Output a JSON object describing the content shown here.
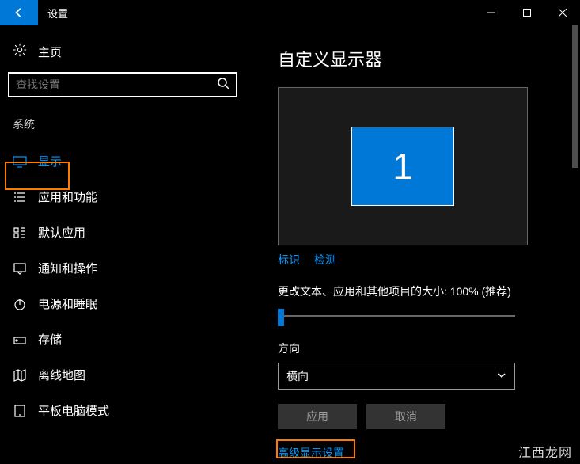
{
  "window": {
    "title": "设置"
  },
  "sidebar": {
    "home": "主页",
    "search_placeholder": "查找设置",
    "category": "系统",
    "items": [
      {
        "label": "显示"
      },
      {
        "label": "应用和功能"
      },
      {
        "label": "默认应用"
      },
      {
        "label": "通知和操作"
      },
      {
        "label": "电源和睡眠"
      },
      {
        "label": "存储"
      },
      {
        "label": "离线地图"
      },
      {
        "label": "平板电脑模式"
      }
    ]
  },
  "main": {
    "heading": "自定义显示器",
    "monitor_number": "1",
    "identify_link": "标识",
    "detect_link": "检测",
    "scale_label": "更改文本、应用和其他项目的大小: 100% (推荐)",
    "orientation_label": "方向",
    "orientation_value": "横向",
    "apply_btn": "应用",
    "cancel_btn": "取消",
    "advanced_link": "高级显示设置"
  },
  "watermark": "江西龙网"
}
